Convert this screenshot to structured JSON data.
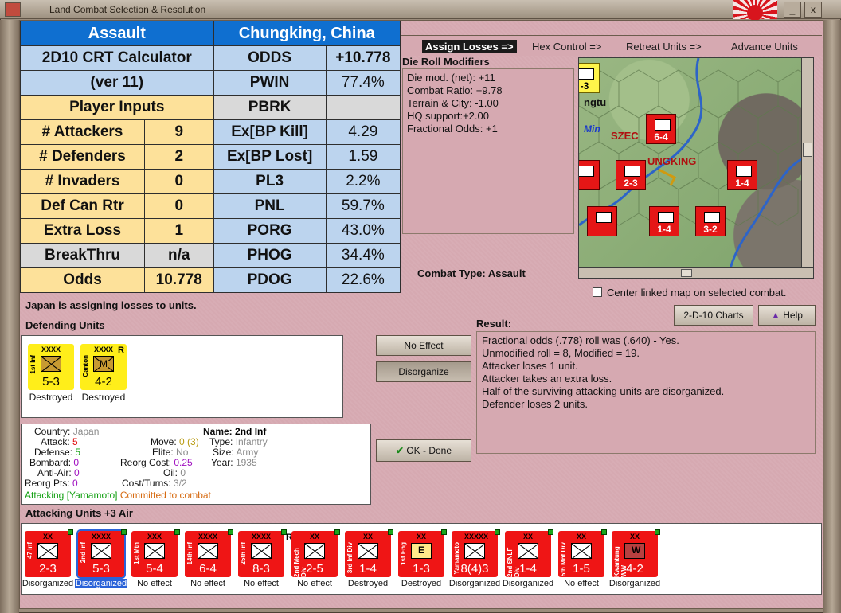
{
  "window": {
    "title": "Land Combat Selection & Resolution",
    "minimize_symbol": "_",
    "close_symbol": "x"
  },
  "crt": {
    "header_left": "Assault",
    "header_right": "Chungking, China",
    "calc_title": "2D10 CRT Calculator",
    "calc_version": "(ver 11)",
    "player_inputs": "Player Inputs",
    "inputs": [
      {
        "label": "# Attackers",
        "value": "9"
      },
      {
        "label": "# Defenders",
        "value": "2"
      },
      {
        "label": "# Invaders",
        "value": "0"
      },
      {
        "label": "Def Can Rtr",
        "value": "0"
      },
      {
        "label": "Extra Loss",
        "value": "1"
      },
      {
        "label": "BreakThru",
        "value": "n/a"
      },
      {
        "label": "Odds",
        "value": "10.778"
      }
    ],
    "outputs": [
      {
        "label": "ODDS",
        "value": "+10.778"
      },
      {
        "label": "PWIN",
        "value": "77.4%"
      },
      {
        "label": "PBRK",
        "value": ""
      },
      {
        "label": "Ex[BP Kill]",
        "value": "4.29"
      },
      {
        "label": "Ex[BP Lost]",
        "value": "1.59"
      },
      {
        "label": "PL3",
        "value": "2.2%"
      },
      {
        "label": "PNL",
        "value": "59.7%"
      },
      {
        "label": "PORG",
        "value": "43.0%"
      },
      {
        "label": "PHOG",
        "value": "34.4%"
      },
      {
        "label": "PDOG",
        "value": "22.6%"
      }
    ]
  },
  "menu": {
    "assign_losses": "Assign Losses =>",
    "hex_control": "Hex Control =>",
    "retreat_units": "Retreat Units =>",
    "advance_units": "Advance Units"
  },
  "drm": {
    "label": "Die Roll Modifiers",
    "lines": [
      "Die mod. (net): +11",
      "",
      "Combat Ratio: +9.78",
      "Terrain & City: -1.00",
      "HQ support:+2.00",
      "Fractional Odds: +1"
    ]
  },
  "map": {
    "city_label": "UNGKING",
    "region_label": "SZEC",
    "town_label": "ngtu",
    "river_label": "Min",
    "units": [
      {
        "value": "6-4",
        "size": "XXXX"
      },
      {
        "value": "2-3",
        "size": "XX"
      },
      {
        "value": "1-4",
        "size": "XX"
      },
      {
        "value": "1-4",
        "size": "XX"
      },
      {
        "value": "3-2",
        "size": "XX"
      },
      {
        "value": "-3",
        "size": "XX"
      }
    ]
  },
  "combat_type": "Combat Type:  Assault",
  "center_map_label": "Center linked map on selected combat.",
  "status": "Japan is assigning losses to units.",
  "defending": {
    "label": "Defending Units",
    "units": [
      {
        "side": "1st Inf",
        "size": "XXXX",
        "strength": "5-3",
        "caption": "Destroyed",
        "letter": ""
      },
      {
        "side": "Canton",
        "size": "XXXX",
        "strength": "4-2",
        "caption": "Destroyed",
        "letter": "M",
        "flag": "R"
      }
    ]
  },
  "buttons": {
    "no_effect": "No Effect",
    "disorganize": "Disorganize",
    "ok_done": "OK - Done",
    "charts": "2-D-10 Charts",
    "help": "Help"
  },
  "result": {
    "label": "Result:",
    "lines": [
      "Fractional odds (.778) roll was (.640)  - Yes.",
      "Unmodified roll = 8, Modified = 19.",
      "Attacker loses 1 unit.",
      "Attacker takes an extra loss.",
      "Half of the surviving attacking units are disorganized.",
      "Defender loses 2 units."
    ]
  },
  "info": {
    "country_k": "Country:",
    "country_v": "Japan",
    "attack_k": "Attack:",
    "attack_v": "5",
    "defense_k": "Defense:",
    "defense_v": "5",
    "bombard_k": "Bombard:",
    "bombard_v": "0",
    "antiair_k": "Anti-Air:",
    "antiair_v": "0",
    "reorg_pts_k": "Reorg Pts:",
    "reorg_pts_v": "0",
    "move_k": "Move:",
    "move_v": "0 (3)",
    "elite_k": "Elite:",
    "elite_v": "No",
    "reorg_cost_k": "Reorg Cost:",
    "reorg_cost_v": "0.25",
    "oil_k": "Oil:",
    "oil_v": "0",
    "cost_turns_k": "Cost/Turns:",
    "cost_turns_v": "3/2",
    "name_k": "Name:",
    "name_v": "2nd Inf",
    "type_k": "Type:",
    "type_v": "Infantry",
    "size_k": "Size:",
    "size_v": "Army",
    "year_k": "Year:",
    "year_v": "1935",
    "attacking_v": "Attacking [Yamamoto]",
    "committed_v": "Committed to combat"
  },
  "attacking": {
    "label": "Attacking Units +3 Air",
    "units": [
      {
        "side": "47 Inf",
        "size": "XX",
        "strength": "2-3",
        "caption": "Disorganized",
        "letter": ""
      },
      {
        "side": "2nd Inf",
        "size": "XXXX",
        "strength": "5-3",
        "caption": "Disorganized",
        "letter": "",
        "selected": true
      },
      {
        "side": "1st Mtn",
        "size": "XXX",
        "strength": "5-4",
        "caption": "No effect",
        "letter": ""
      },
      {
        "side": "14th Inf",
        "size": "XXXX",
        "strength": "6-4",
        "caption": "No effect",
        "letter": ""
      },
      {
        "side": "25th Inf",
        "size": "XXXX",
        "strength": "8-3",
        "caption": "No effect",
        "letter": "",
        "flag": "R"
      },
      {
        "side": "2nd Mech Div",
        "size": "XX",
        "strength": "2-5",
        "caption": "No effect",
        "letter": ""
      },
      {
        "side": "3rd Inf Div",
        "size": "XX",
        "strength": "1-4",
        "caption": "Destroyed",
        "letter": ""
      },
      {
        "side": "1st Eng",
        "size": "XX",
        "strength": "1-3",
        "caption": "Destroyed",
        "letter": "E"
      },
      {
        "side": "Yamamoto",
        "size": "XXXXX",
        "strength": "8(4)3",
        "caption": "Disorganized",
        "letter": ""
      },
      {
        "side": "2nd SNLF Div",
        "size": "XX",
        "strength": "1-4",
        "caption": "Disorganized",
        "letter": ""
      },
      {
        "side": "5th Mnt Div",
        "size": "XX",
        "strength": "1-5",
        "caption": "No effect",
        "letter": ""
      },
      {
        "side": "Kwantung WW",
        "size": "XX",
        "strength": "4-2",
        "caption": "Disorganized",
        "letter": "W"
      }
    ]
  }
}
